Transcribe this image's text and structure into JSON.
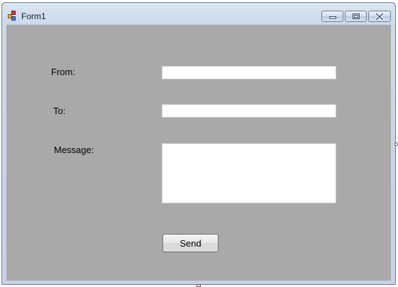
{
  "window": {
    "title": "Form1",
    "icon": "winforms-app-icon",
    "controls": {
      "minimize_icon": "minimize-icon",
      "maximize_icon": "maximize-icon",
      "close_icon": "close-icon"
    }
  },
  "form": {
    "from_label": "From:",
    "from_value": "",
    "to_label": "To:",
    "to_value": "",
    "message_label": "Message:",
    "message_value": "",
    "send_label": "Send"
  },
  "colors": {
    "client_background": "#a9a9a9",
    "title_bar": "#cbd9ea"
  }
}
